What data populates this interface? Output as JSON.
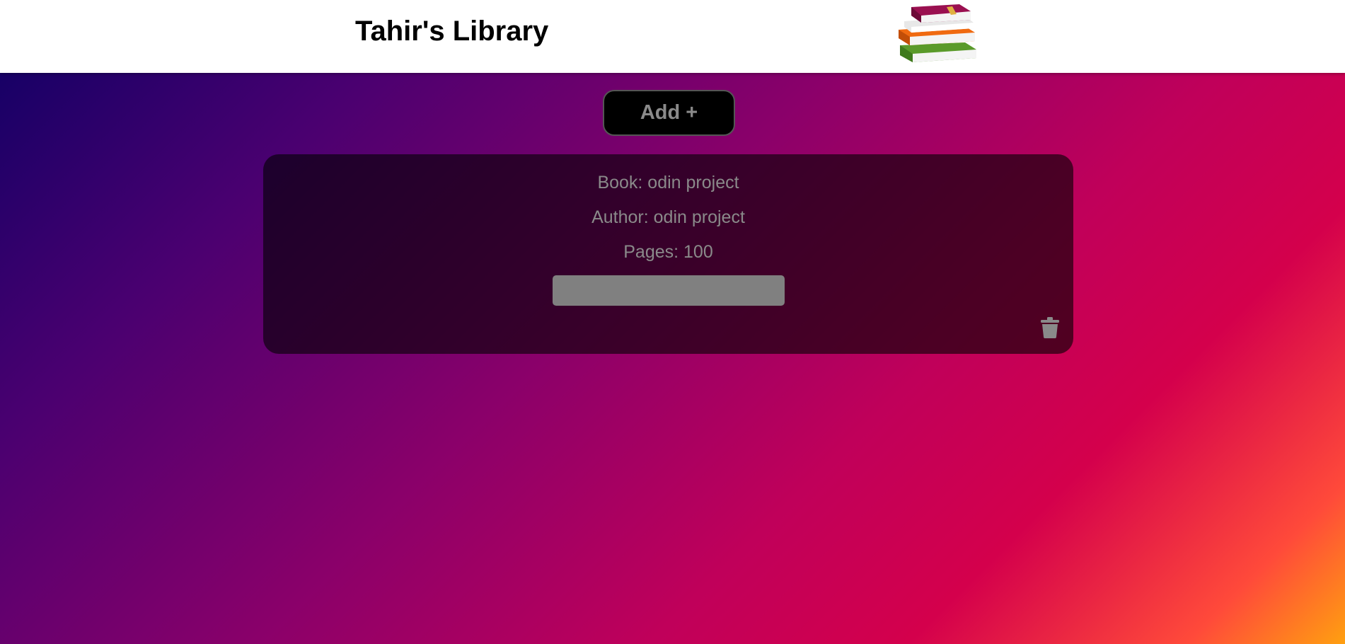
{
  "header": {
    "title": "Tahir's Library",
    "logo_icon": "books-stack-icon"
  },
  "toolbar": {
    "add_label": "Add +"
  },
  "books": [
    {
      "book_line": "Book: odin project",
      "author_line": "Author: odin project",
      "pages_line": "Pages: 100",
      "status_label": "",
      "delete_icon": "trash-icon"
    }
  ],
  "colors": {
    "header_bg": "#ffffff",
    "button_bg": "#000000",
    "text_muted": "#8a8a8a",
    "status_button": "#808080",
    "gradient": [
      "#0d0064",
      "#4a0070",
      "#8a006a",
      "#c0005a",
      "#d4004c",
      "#ff4a3a",
      "#ffa010"
    ]
  }
}
